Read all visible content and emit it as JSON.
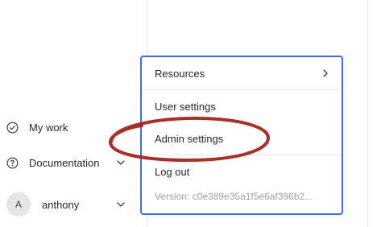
{
  "sidebar": {
    "items": [
      {
        "label": "My work",
        "icon": "check-circle-icon"
      },
      {
        "label": "Documentation",
        "icon": "help-circle-icon",
        "chevron": "chevron-down-icon"
      }
    ],
    "user": {
      "initial": "A",
      "name": "anthony",
      "chevron": "chevron-down-icon"
    }
  },
  "menu": {
    "items": [
      {
        "label": "Resources",
        "chevron": "chevron-right-icon"
      },
      {
        "label": "User settings"
      },
      {
        "label": "Admin settings"
      },
      {
        "label": "Log out"
      }
    ],
    "version_text": "Version: c0e389e35a1f5e6af396b2..."
  },
  "colors": {
    "menu_border": "#3b6fe0",
    "annotation": "#a6231c",
    "muted_text": "#9aa1a9"
  }
}
